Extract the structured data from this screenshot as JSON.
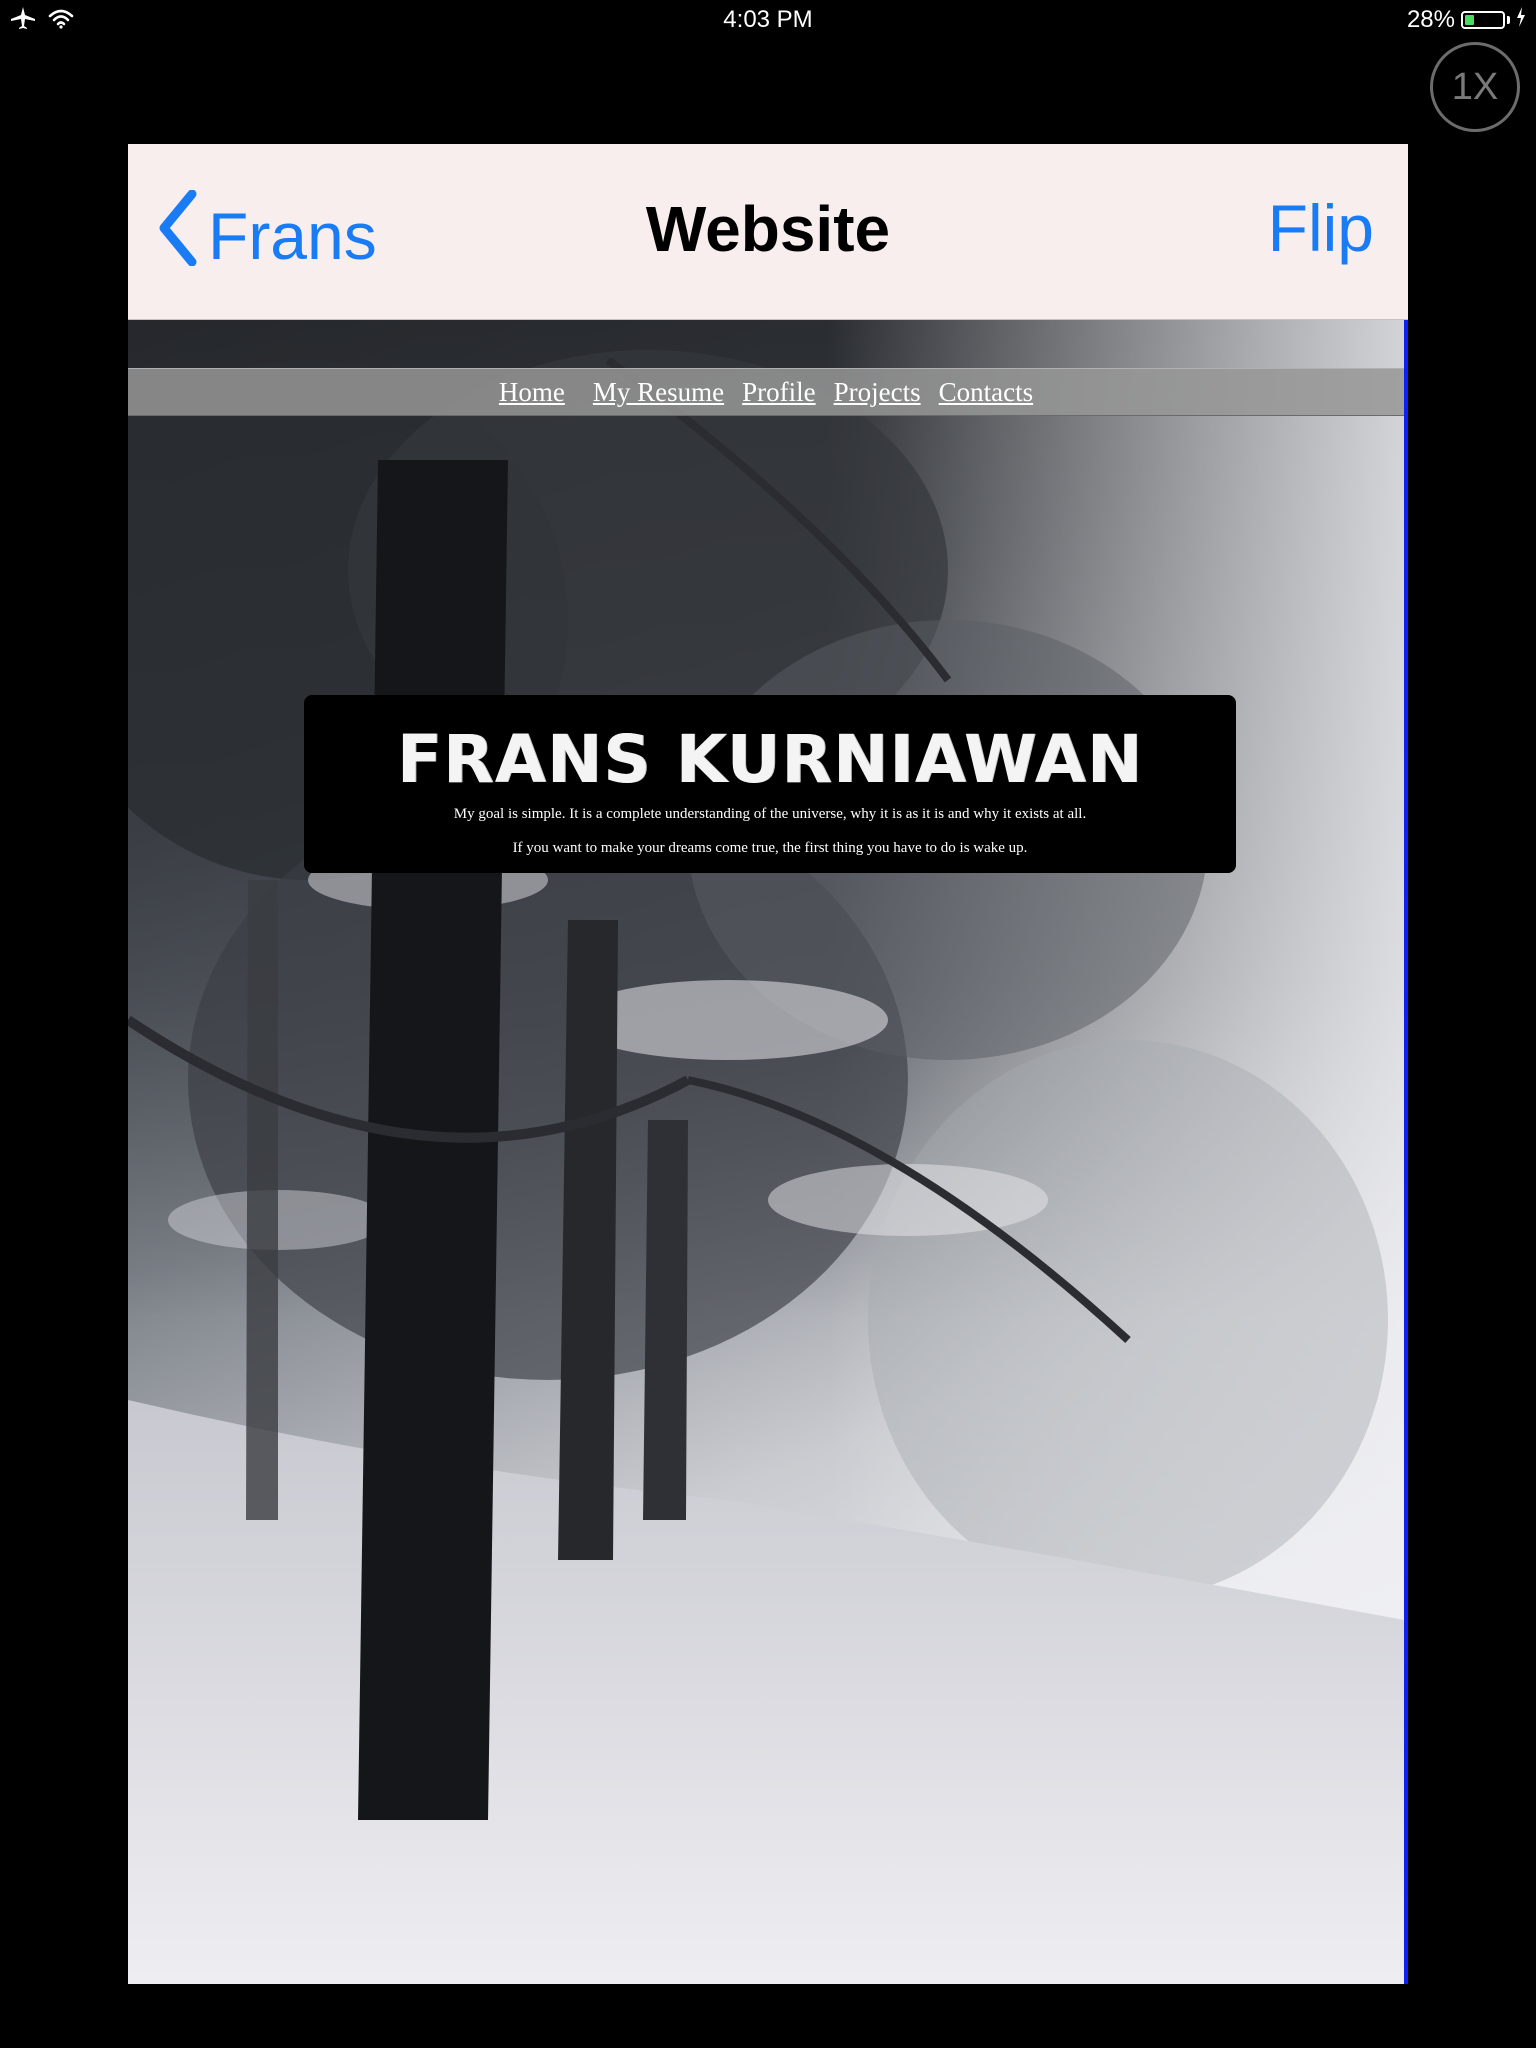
{
  "status_bar": {
    "time": "4:03 PM",
    "battery_percent_text": "28%",
    "battery_level": 0.28,
    "battery_color": "#4cd964",
    "icons": [
      "airplane-icon",
      "wifi-icon",
      "battery-icon",
      "charging-bolt-icon"
    ]
  },
  "zoom_button": {
    "label": "1X"
  },
  "nav_bar": {
    "back_label": "Frans",
    "title": "Website",
    "right_label": "Flip",
    "accent_color": "#1a7cf5",
    "background_color": "#f8eeed"
  },
  "website": {
    "nav_links": [
      "Home",
      "My Resume",
      "Profile",
      "Projects",
      "Contacts"
    ],
    "heading": "FRANS KURNIAWAN",
    "lines": [
      "My goal is simple. It is a complete understanding of the universe, why it is as it is and why it exists at all.",
      "If you want to make your dreams come true, the first thing you have to do is wake up."
    ]
  }
}
